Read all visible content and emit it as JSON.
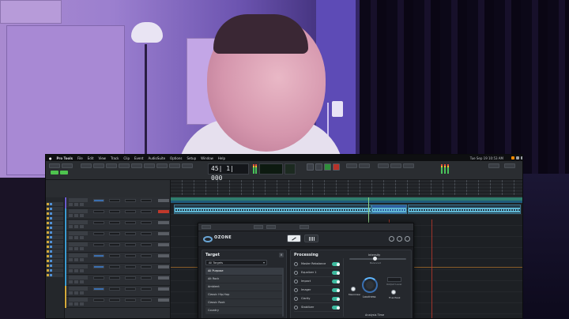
{
  "menubar": {
    "app": "Pro Tools",
    "items": [
      "File",
      "Edit",
      "View",
      "Track",
      "Clip",
      "Event",
      "AudioSuite",
      "Options",
      "Setup",
      "Window",
      "Help"
    ],
    "document": "",
    "clock": "Tue Sep 19 10:53 AM"
  },
  "transport": {
    "main_counter": "45| 1| 000"
  },
  "plugin": {
    "brand": "OZONE",
    "target": {
      "title": "Target",
      "selected": "All Targets",
      "items": [
        "All Purpose",
        "Alt Rock",
        "Ambient",
        "Classic Hip-Hop",
        "Classic Rock",
        "Country"
      ]
    },
    "processing": {
      "title": "Processing",
      "modules": [
        "Master Rebalance",
        "Equalizer 1",
        "Impact",
        "Imager",
        "Clarity",
        "Stabilizer"
      ],
      "intensity_label": "Intensity",
      "intensity_value": "Balanced",
      "maximizer_label": "Maximizer",
      "loudness_label": "Loudness",
      "output_label": "Output Level",
      "truepeak_label": "True Peak",
      "analysis_label": "Analysis Time"
    }
  }
}
